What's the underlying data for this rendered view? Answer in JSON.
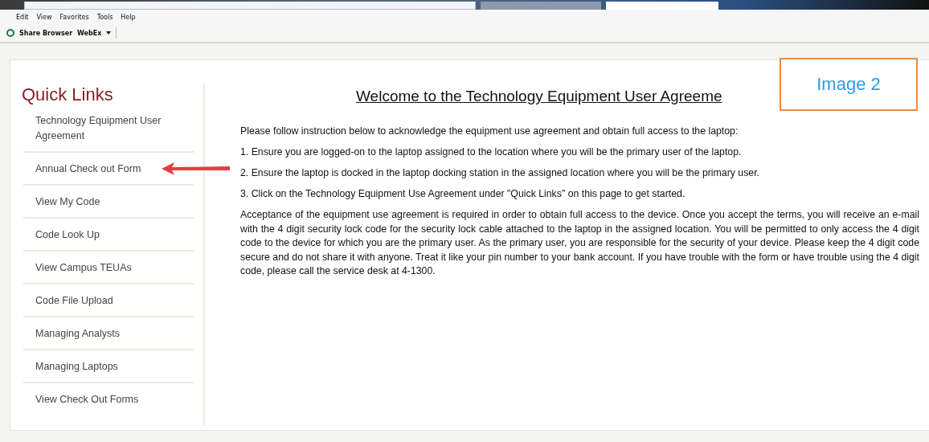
{
  "menu_bar": [
    "Edit",
    "View",
    "Favorites",
    "Tools",
    "Help"
  ],
  "toolbar": {
    "share_label": "Share Browser",
    "webex_label": "WebEx"
  },
  "sidebar": {
    "title": "Quick Links",
    "items": [
      {
        "label": "Technology Equipment User Agreement",
        "annotated": false
      },
      {
        "label": "Annual Check out Form",
        "annotated": true
      },
      {
        "label": "View My Code",
        "annotated": false
      },
      {
        "label": "Code Look Up",
        "annotated": false
      },
      {
        "label": "View Campus TEUAs",
        "annotated": false
      },
      {
        "label": "Code File Upload",
        "annotated": false
      },
      {
        "label": "Managing Analysts",
        "annotated": false
      },
      {
        "label": "Managing Laptops",
        "annotated": false
      },
      {
        "label": "View Check Out Forms",
        "annotated": false
      }
    ]
  },
  "main": {
    "heading": "Welcome to the Technology Equipment User Agreeme",
    "intro": "Please follow instruction below to acknowledge the equipment use agreement and obtain full access to the laptop:",
    "steps": [
      "1. Ensure you are logged-on to the laptop assigned to the location where you will be the primary user of the laptop.",
      "2. Ensure the laptop is docked in the laptop docking station in the assigned location where you will be the primary user.",
      "3. Click on the Technology Equipment Use Agreement under \"Quick Links\" on this page to get started."
    ],
    "body": "Acceptance of the equipment use agreement is required in order to obtain full access to the device. Once you accept the terms, you will receive an e-mail with the 4 digit security lock code for the security lock cable attached to the laptop in the assigned location. You will be permitted to only access the 4 digit code to the device for which you are the primary user. As the primary user, you are responsible for the security of your device. Please keep the 4 digit code secure and do not share it with anyone. Treat it like your pin number to your bank account. If you have trouble with the form or have trouble using the 4 digit code, please call the service desk at 4-1300."
  },
  "annotation_label": "Image 2"
}
